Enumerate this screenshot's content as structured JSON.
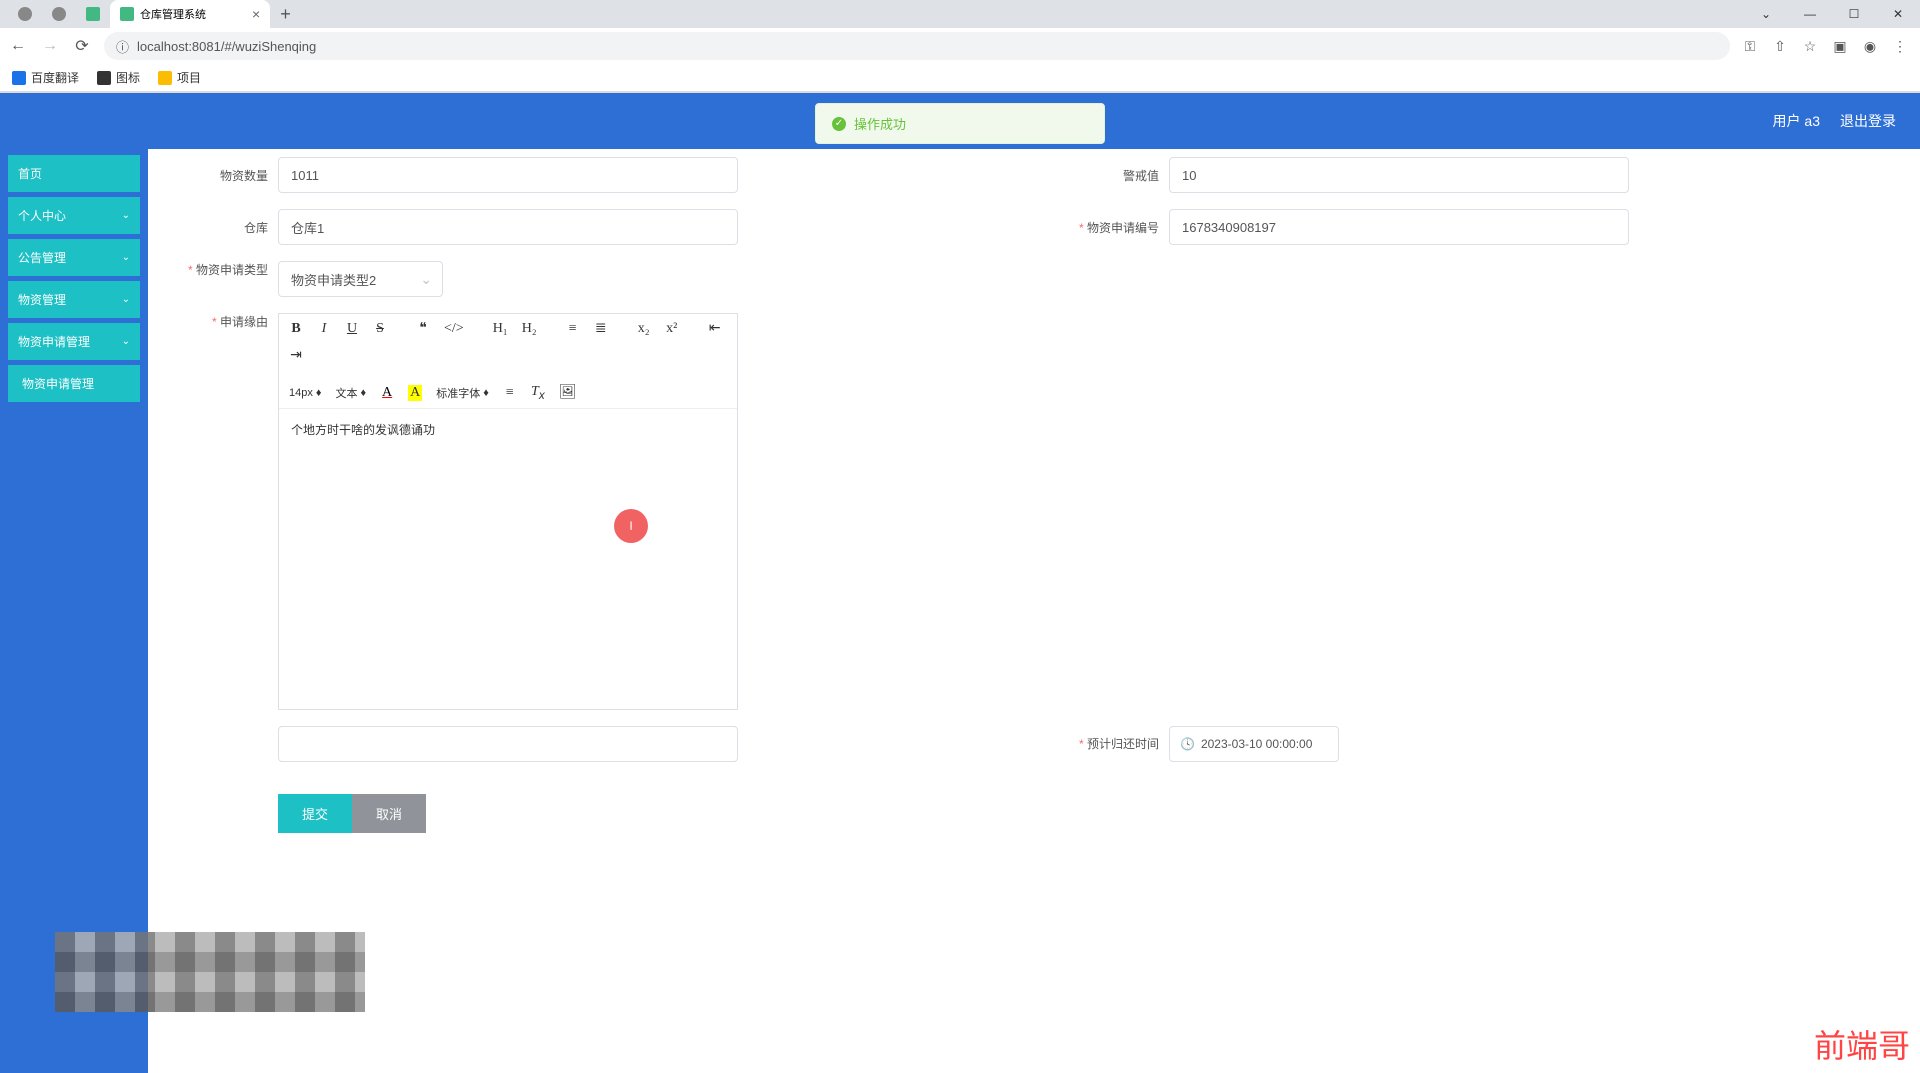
{
  "browser": {
    "tabs": [
      {
        "title": "",
        "active": false
      },
      {
        "title": "",
        "active": false
      },
      {
        "title": "仓库管理系统",
        "active": true
      }
    ],
    "url": "localhost:8081/#/wuziShenqing",
    "bookmarks": [
      {
        "label": "百度翻译"
      },
      {
        "label": "图标"
      },
      {
        "label": "项目"
      }
    ]
  },
  "header": {
    "user_label": "用户 a3",
    "logout": "退出登录",
    "toast": "操作成功"
  },
  "sidebar": {
    "items": [
      {
        "label": "首页",
        "expandable": false
      },
      {
        "label": "个人中心",
        "expandable": true
      },
      {
        "label": "公告管理",
        "expandable": true
      },
      {
        "label": "物资管理",
        "expandable": true
      },
      {
        "label": "物资申请管理",
        "expandable": true
      },
      {
        "label": "物资申请管理",
        "expandable": false,
        "sub": true
      }
    ]
  },
  "form": {
    "wuzi_shuliang_label": "物资数量",
    "wuzi_shuliang_value": "1011",
    "jingjie_label": "警戒值",
    "jingjie_value": "10",
    "cangku_label": "仓库",
    "cangku_value": "仓库1",
    "shenqing_bianhao_label": "物资申请编号",
    "shenqing_bianhao_value": "1678340908197",
    "shenqing_leixing_label": "物资申请类型",
    "shenqing_leixing_value": "物资申请类型2",
    "shenqing_yuanyou_label": "申请缘由",
    "editor_content": "个地方时干啥的发讽德诵功",
    "guihuan_label": "预计归还时间",
    "guihuan_value": "2023-03-10 00:00:00",
    "submit": "提交",
    "cancel": "取消"
  },
  "editor": {
    "font_size": "14px",
    "text_type": "文本",
    "font_family": "标准字体"
  },
  "watermark": "前端哥"
}
